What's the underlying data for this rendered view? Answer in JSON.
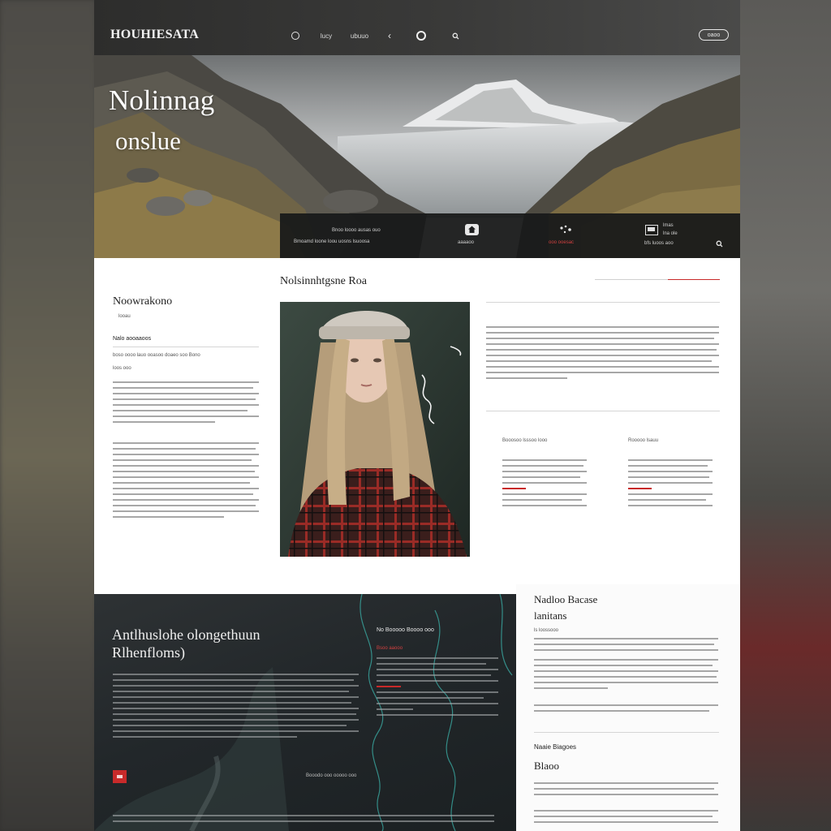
{
  "header": {
    "brand": "HOUHIESATA",
    "nav": [
      {
        "icon": "circle-icon"
      },
      {
        "label": "lucy"
      },
      {
        "label": "ubuuo"
      },
      {
        "icon": "chevron-left-icon"
      },
      {
        "icon": "ring-icon"
      },
      {
        "icon": "search-icon"
      }
    ],
    "button_label": "oaoo"
  },
  "hero": {
    "title": "Nolinnag",
    "subtitle": "onslue",
    "bar": {
      "text_1": "Bnoo loooo ausas ouo",
      "text_2": "Bmoamd loone loou uosns lsuoosa",
      "center_label": "aaaaoo",
      "red_label": "ooo ooesac",
      "right_label_1": "lmas",
      "right_label_2": "lna ole",
      "right_label_3": "bfs luoos aoo"
    }
  },
  "main": {
    "left_heading": "Noowrakono",
    "left_sub": "looau",
    "left_label": "Nalo aooaaoos",
    "left_meta": "boso oooo lauo ooasoo doaeo soo Bono",
    "left_date": "loos ooo",
    "center_heading": "Nolsinnhtgsne Roa",
    "col_head_1": "Booosoo lsssoo looo",
    "col_head_2": "Rooooo lsauu"
  },
  "feature": {
    "title_1": "Antlhuslohe olongethuun",
    "title_2": "Rlhenfloms)",
    "subhead": "No Booooo Boooo ooo",
    "red_label": "Bsoo aaooo",
    "bottom_right": "Booodo ooo ooooo ooo"
  },
  "sidebar": {
    "heading_1": "Nadloo Bacase",
    "heading_2": "lanitans",
    "sub_label": "ls loossooo",
    "mid_label": "Naaie Biagoes",
    "heading_3": "Blaoo"
  },
  "colors": {
    "accent_red": "#c82a2a",
    "dark_bar": "#18191a",
    "text_dark": "#1f1f1f"
  }
}
